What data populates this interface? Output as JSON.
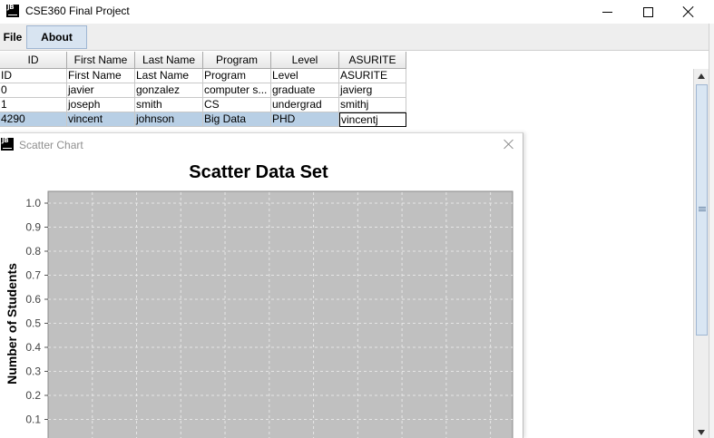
{
  "window": {
    "title": "CSE360 Final Project",
    "logo_text": "JB"
  },
  "menu": {
    "file_label": "File",
    "about_label": "About"
  },
  "table": {
    "headers": [
      "ID",
      "First Name",
      "Last Name",
      "Program",
      "Level",
      "ASURITE"
    ],
    "rows": [
      [
        "ID",
        "First Name",
        "Last Name",
        "Program",
        "Level",
        "ASURITE"
      ],
      [
        "0",
        "javier",
        "gonzalez",
        "computer s...",
        "graduate",
        "javierg"
      ],
      [
        "1",
        "joseph",
        "smith",
        "CS",
        "undergrad",
        "smithj"
      ],
      [
        "4290",
        "vincent",
        "johnson",
        "Big Data",
        "PHD",
        "vincentj"
      ]
    ],
    "selected_row_index": 3,
    "editing_cell": "vincentj"
  },
  "chart_window": {
    "title": "Scatter Chart",
    "logo_text": "JB"
  },
  "chart_data": {
    "type": "scatter",
    "title": "Scatter Data Set",
    "xlabel": "",
    "ylabel": "Number of Students",
    "ylim": [
      0,
      1.0
    ],
    "yticks": [
      "1.0",
      "0.9",
      "0.8",
      "0.7",
      "0.6",
      "0.5",
      "0.4",
      "0.3",
      "0.2",
      "0.1"
    ],
    "series": [],
    "grid": true,
    "plot_background": "#c0c0c0"
  },
  "colors": {
    "selected_row": "#b8cfe5",
    "menu_active": "#d8e4f1",
    "plot_background": "#c0c0c0",
    "gridline": "#e6e6e6"
  }
}
